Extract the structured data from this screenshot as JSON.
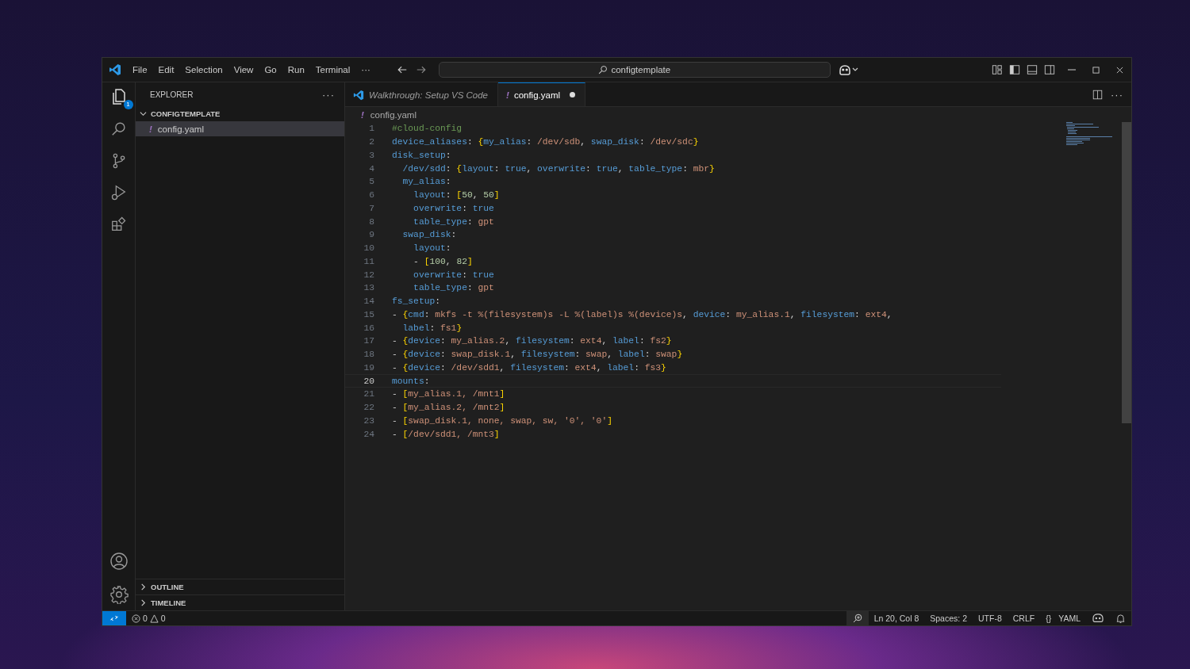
{
  "menu": [
    "File",
    "Edit",
    "Selection",
    "View",
    "Go",
    "Run",
    "Terminal",
    "···"
  ],
  "command_center": {
    "value": "configtemplate"
  },
  "activity_bar": {
    "explorer_badge": "1"
  },
  "sidebar": {
    "title": "EXPLORER",
    "more": "···",
    "sections": [
      {
        "title": "CONFIGTEMPLATE",
        "expanded": true,
        "files": [
          {
            "icon": "!",
            "name": "config.yaml",
            "selected": true
          }
        ]
      },
      {
        "title": "OUTLINE",
        "expanded": false
      },
      {
        "title": "TIMELINE",
        "expanded": false
      }
    ]
  },
  "tabs": [
    {
      "label": "Walkthrough: Setup VS Code",
      "kind": "welcome",
      "selected": false,
      "preview": true,
      "modified": false
    },
    {
      "label": "config.yaml",
      "kind": "yaml",
      "icon": "!",
      "selected": true,
      "preview": false,
      "modified": true
    }
  ],
  "editor_more": "···",
  "breadcrumb": {
    "icon": "!",
    "name": "config.yaml"
  },
  "lines": [
    {
      "number": "1",
      "active": false,
      "tokens": [
        {
          "kind": "comment",
          "text": "#cloud-config"
        }
      ]
    },
    {
      "number": "2",
      "active": false,
      "tokens": [
        {
          "kind": "key",
          "text": "device_aliases"
        },
        {
          "kind": "punct",
          "text": ": "
        },
        {
          "kind": "bracket",
          "text": "{"
        },
        {
          "kind": "key",
          "text": "my_alias"
        },
        {
          "kind": "punct",
          "text": ": "
        },
        {
          "kind": "string",
          "text": "/dev/sdb"
        },
        {
          "kind": "punct",
          "text": ", "
        },
        {
          "kind": "key",
          "text": "swap_disk"
        },
        {
          "kind": "punct",
          "text": ": "
        },
        {
          "kind": "string",
          "text": "/dev/sdc"
        },
        {
          "kind": "bracket",
          "text": "}"
        }
      ]
    },
    {
      "number": "3",
      "active": false,
      "tokens": [
        {
          "kind": "key",
          "text": "disk_setup"
        },
        {
          "kind": "punct",
          "text": ":"
        }
      ]
    },
    {
      "number": "4",
      "active": false,
      "tokens": [
        {
          "kind": "key",
          "text": "  /dev/sdd"
        },
        {
          "kind": "punct",
          "text": ": "
        },
        {
          "kind": "bracket",
          "text": "{"
        },
        {
          "kind": "key",
          "text": "layout"
        },
        {
          "kind": "punct",
          "text": ": "
        },
        {
          "kind": "bool",
          "text": "true"
        },
        {
          "kind": "punct",
          "text": ", "
        },
        {
          "kind": "key",
          "text": "overwrite"
        },
        {
          "kind": "punct",
          "text": ": "
        },
        {
          "kind": "bool",
          "text": "true"
        },
        {
          "kind": "punct",
          "text": ", "
        },
        {
          "kind": "key",
          "text": "table_type"
        },
        {
          "kind": "punct",
          "text": ": "
        },
        {
          "kind": "string",
          "text": "mbr"
        },
        {
          "kind": "bracket",
          "text": "}"
        }
      ]
    },
    {
      "number": "5",
      "active": false,
      "tokens": [
        {
          "kind": "key",
          "text": "  my_alias"
        },
        {
          "kind": "punct",
          "text": ":"
        }
      ]
    },
    {
      "number": "6",
      "active": false,
      "tokens": [
        {
          "kind": "key",
          "text": "    layout"
        },
        {
          "kind": "punct",
          "text": ": "
        },
        {
          "kind": "bracket",
          "text": "["
        },
        {
          "kind": "number",
          "text": "50"
        },
        {
          "kind": "punct",
          "text": ", "
        },
        {
          "kind": "number",
          "text": "50"
        },
        {
          "kind": "bracket",
          "text": "]"
        }
      ]
    },
    {
      "number": "7",
      "active": false,
      "tokens": [
        {
          "kind": "key",
          "text": "    overwrite"
        },
        {
          "kind": "punct",
          "text": ": "
        },
        {
          "kind": "bool",
          "text": "true"
        }
      ]
    },
    {
      "number": "8",
      "active": false,
      "tokens": [
        {
          "kind": "key",
          "text": "    table_type"
        },
        {
          "kind": "punct",
          "text": ": "
        },
        {
          "kind": "string",
          "text": "gpt"
        }
      ]
    },
    {
      "number": "9",
      "active": false,
      "tokens": [
        {
          "kind": "key",
          "text": "  swap_disk"
        },
        {
          "kind": "punct",
          "text": ":"
        }
      ]
    },
    {
      "number": "10",
      "active": false,
      "tokens": [
        {
          "kind": "key",
          "text": "    layout"
        },
        {
          "kind": "punct",
          "text": ":"
        }
      ]
    },
    {
      "number": "11",
      "active": false,
      "tokens": [
        {
          "kind": "punct",
          "text": "    - "
        },
        {
          "kind": "bracket",
          "text": "["
        },
        {
          "kind": "number",
          "text": "100"
        },
        {
          "kind": "punct",
          "text": ", "
        },
        {
          "kind": "number",
          "text": "82"
        },
        {
          "kind": "bracket",
          "text": "]"
        }
      ]
    },
    {
      "number": "12",
      "active": false,
      "tokens": [
        {
          "kind": "key",
          "text": "    overwrite"
        },
        {
          "kind": "punct",
          "text": ": "
        },
        {
          "kind": "bool",
          "text": "true"
        }
      ]
    },
    {
      "number": "13",
      "active": false,
      "tokens": [
        {
          "kind": "key",
          "text": "    table_type"
        },
        {
          "kind": "punct",
          "text": ": "
        },
        {
          "kind": "string",
          "text": "gpt"
        }
      ]
    },
    {
      "number": "14",
      "active": false,
      "tokens": [
        {
          "kind": "key",
          "text": "fs_setup"
        },
        {
          "kind": "punct",
          "text": ":"
        }
      ]
    },
    {
      "number": "15",
      "active": false,
      "tokens": [
        {
          "kind": "punct",
          "text": "- "
        },
        {
          "kind": "bracket",
          "text": "{"
        },
        {
          "kind": "key",
          "text": "cmd"
        },
        {
          "kind": "punct",
          "text": ": "
        },
        {
          "kind": "string",
          "text": "mkfs -t %(filesystem)s -L %(label)s %(device)s"
        },
        {
          "kind": "punct",
          "text": ", "
        },
        {
          "kind": "key",
          "text": "device"
        },
        {
          "kind": "punct",
          "text": ": "
        },
        {
          "kind": "string",
          "text": "my_alias.1"
        },
        {
          "kind": "punct",
          "text": ", "
        },
        {
          "kind": "key",
          "text": "filesystem"
        },
        {
          "kind": "punct",
          "text": ": "
        },
        {
          "kind": "string",
          "text": "ext4"
        },
        {
          "kind": "punct",
          "text": ","
        }
      ]
    },
    {
      "number": "16",
      "active": false,
      "tokens": [
        {
          "kind": "key",
          "text": "  label"
        },
        {
          "kind": "punct",
          "text": ": "
        },
        {
          "kind": "string",
          "text": "fs1"
        },
        {
          "kind": "bracket",
          "text": "}"
        }
      ]
    },
    {
      "number": "17",
      "active": false,
      "tokens": [
        {
          "kind": "punct",
          "text": "- "
        },
        {
          "kind": "bracket",
          "text": "{"
        },
        {
          "kind": "key",
          "text": "device"
        },
        {
          "kind": "punct",
          "text": ": "
        },
        {
          "kind": "string",
          "text": "my_alias.2"
        },
        {
          "kind": "punct",
          "text": ", "
        },
        {
          "kind": "key",
          "text": "filesystem"
        },
        {
          "kind": "punct",
          "text": ": "
        },
        {
          "kind": "string",
          "text": "ext4"
        },
        {
          "kind": "punct",
          "text": ", "
        },
        {
          "kind": "key",
          "text": "label"
        },
        {
          "kind": "punct",
          "text": ": "
        },
        {
          "kind": "string",
          "text": "fs2"
        },
        {
          "kind": "bracket",
          "text": "}"
        }
      ]
    },
    {
      "number": "18",
      "active": false,
      "tokens": [
        {
          "kind": "punct",
          "text": "- "
        },
        {
          "kind": "bracket",
          "text": "{"
        },
        {
          "kind": "key",
          "text": "device"
        },
        {
          "kind": "punct",
          "text": ": "
        },
        {
          "kind": "string",
          "text": "swap_disk.1"
        },
        {
          "kind": "punct",
          "text": ", "
        },
        {
          "kind": "key",
          "text": "filesystem"
        },
        {
          "kind": "punct",
          "text": ": "
        },
        {
          "kind": "string",
          "text": "swap"
        },
        {
          "kind": "punct",
          "text": ", "
        },
        {
          "kind": "key",
          "text": "label"
        },
        {
          "kind": "punct",
          "text": ": "
        },
        {
          "kind": "string",
          "text": "swap"
        },
        {
          "kind": "bracket",
          "text": "}"
        }
      ]
    },
    {
      "number": "19",
      "active": false,
      "tokens": [
        {
          "kind": "punct",
          "text": "- "
        },
        {
          "kind": "bracket",
          "text": "{"
        },
        {
          "kind": "key",
          "text": "device"
        },
        {
          "kind": "punct",
          "text": ": "
        },
        {
          "kind": "string",
          "text": "/dev/sdd1"
        },
        {
          "kind": "punct",
          "text": ", "
        },
        {
          "kind": "key",
          "text": "filesystem"
        },
        {
          "kind": "punct",
          "text": ": "
        },
        {
          "kind": "string",
          "text": "ext4"
        },
        {
          "kind": "punct",
          "text": ", "
        },
        {
          "kind": "key",
          "text": "label"
        },
        {
          "kind": "punct",
          "text": ": "
        },
        {
          "kind": "string",
          "text": "fs3"
        },
        {
          "kind": "bracket",
          "text": "}"
        }
      ]
    },
    {
      "number": "20",
      "active": true,
      "tokens": [
        {
          "kind": "key",
          "text": "mounts"
        },
        {
          "kind": "punct",
          "text": ":"
        }
      ]
    },
    {
      "number": "21",
      "active": false,
      "tokens": [
        {
          "kind": "punct",
          "text": "- "
        },
        {
          "kind": "bracket",
          "text": "["
        },
        {
          "kind": "string",
          "text": "my_alias.1, /mnt1"
        },
        {
          "kind": "bracket",
          "text": "]"
        }
      ]
    },
    {
      "number": "22",
      "active": false,
      "tokens": [
        {
          "kind": "punct",
          "text": "- "
        },
        {
          "kind": "bracket",
          "text": "["
        },
        {
          "kind": "string",
          "text": "my_alias.2, /mnt2"
        },
        {
          "kind": "bracket",
          "text": "]"
        }
      ]
    },
    {
      "number": "23",
      "active": false,
      "tokens": [
        {
          "kind": "punct",
          "text": "- "
        },
        {
          "kind": "bracket",
          "text": "["
        },
        {
          "kind": "string",
          "text": "swap_disk.1, none, swap, sw, '0', '0'"
        },
        {
          "kind": "bracket",
          "text": "]"
        }
      ]
    },
    {
      "number": "24",
      "active": false,
      "tokens": [
        {
          "kind": "punct",
          "text": "- "
        },
        {
          "kind": "bracket",
          "text": "["
        },
        {
          "kind": "string",
          "text": "/dev/sdd1, /mnt3"
        },
        {
          "kind": "bracket",
          "text": "]"
        }
      ]
    }
  ],
  "status_bar": {
    "errors": "0",
    "warnings": "0",
    "position": "Ln 20, Col 8",
    "indent": "Spaces: 2",
    "encoding": "UTF-8",
    "eol": "CRLF",
    "language_icon": "{}",
    "language": "YAML"
  }
}
